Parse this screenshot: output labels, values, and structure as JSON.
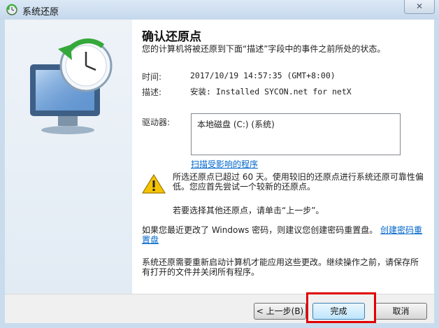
{
  "window": {
    "title": "系统还原",
    "close_label": "✕"
  },
  "content": {
    "heading": "确认还原点",
    "description": "您的计算机将被还原到下面“描述”字段中的事件之前所处的状态。",
    "time_label": "时间:",
    "time_value": "2017/10/19 14:57:35 (GMT+8:00)",
    "desc_label": "描述:",
    "desc_value": "安装: Installed SYCON.net for netX",
    "drives_label": "驱动器:",
    "drives": [
      "本地磁盘 (C:) (系统)"
    ],
    "scan_link": "扫描受影响的程序",
    "warning_text": "所选还原点已超过 60 天。使用较旧的还原点进行系统还原可靠性偏低。您应首先尝试一个较新的还原点。",
    "hint_text": "若要选择其他还原点，请单击“上一步”。",
    "password_text": "如果您最近更改了 Windows 密码，则建议您创建密码重置盘。",
    "password_link": "创建密码重置盘",
    "restart_text": "系统还原需要重新启动计算机才能应用这些更改。继续操作之前，请保存所有打开的文件并关闭所有程序。"
  },
  "buttons": {
    "back": "< 上一步(B)",
    "finish": "完成",
    "cancel": "取消"
  },
  "colors": {
    "link": "#0066cc",
    "highlight_box": "#e00000"
  }
}
